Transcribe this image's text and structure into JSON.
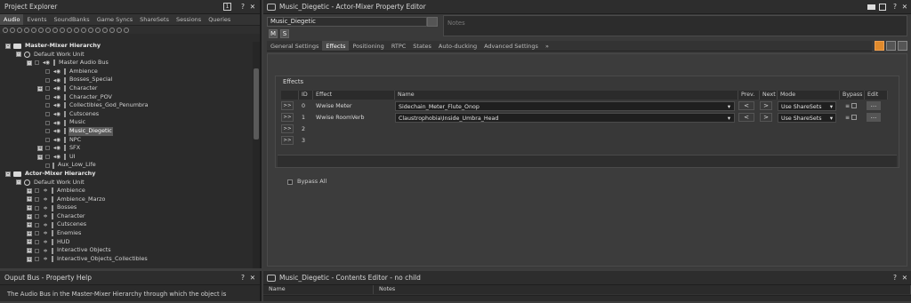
{
  "colors": {
    "accent": "#e08a2c",
    "panel": "#2b2b2b",
    "header": "#2d2d2d"
  },
  "project_explorer": {
    "title": "Project Explorer",
    "tabs": [
      "Audio",
      "Events",
      "SoundBanks",
      "Game Syncs",
      "ShareSets",
      "Sessions",
      "Queries"
    ],
    "tree": [
      {
        "label": "Master-Mixer Hierarchy",
        "indent": 0,
        "kind": "folder",
        "expander": "-",
        "header": true
      },
      {
        "label": "Default Work Unit",
        "indent": 1,
        "kind": "workunit",
        "expander": "-"
      },
      {
        "label": "Master Audio Bus",
        "indent": 2,
        "kind": "bus",
        "expander": "-"
      },
      {
        "label": "Ambience",
        "indent": 3,
        "kind": "bus",
        "expander": ""
      },
      {
        "label": "Bosses_Special",
        "indent": 3,
        "kind": "bus",
        "expander": ""
      },
      {
        "label": "Character",
        "indent": 3,
        "kind": "bus",
        "expander": "+"
      },
      {
        "label": "Character_POV",
        "indent": 3,
        "kind": "bus",
        "expander": ""
      },
      {
        "label": "Collectibles_God_Penumbra",
        "indent": 3,
        "kind": "bus",
        "expander": ""
      },
      {
        "label": "Cutscenes",
        "indent": 3,
        "kind": "bus",
        "expander": ""
      },
      {
        "label": "Music",
        "indent": 3,
        "kind": "bus",
        "expander": ""
      },
      {
        "label": "Music_Diegetic",
        "indent": 3,
        "kind": "bus",
        "expander": "",
        "selected": true
      },
      {
        "label": "NPC",
        "indent": 3,
        "kind": "bus",
        "expander": ""
      },
      {
        "label": "SFX",
        "indent": 3,
        "kind": "bus",
        "expander": "+"
      },
      {
        "label": "UI",
        "indent": 3,
        "kind": "bus",
        "expander": "+"
      },
      {
        "label": "Aux_Low_Life",
        "indent": 3,
        "kind": "bar",
        "expander": ""
      },
      {
        "label": "Actor-Mixer Hierarchy",
        "indent": 0,
        "kind": "folder",
        "expander": "-",
        "header": true
      },
      {
        "label": "Default Work Unit",
        "indent": 1,
        "kind": "workunit",
        "expander": "-"
      },
      {
        "label": "Ambience",
        "indent": 2,
        "kind": "mixer",
        "expander": "+"
      },
      {
        "label": "Ambience_Marzo",
        "indent": 2,
        "kind": "mixer",
        "expander": "+"
      },
      {
        "label": "Bosses",
        "indent": 2,
        "kind": "mixer",
        "expander": "+"
      },
      {
        "label": "Character",
        "indent": 2,
        "kind": "mixer",
        "expander": "+"
      },
      {
        "label": "Cutscenes",
        "indent": 2,
        "kind": "mixer",
        "expander": "+"
      },
      {
        "label": "Enemies",
        "indent": 2,
        "kind": "mixer",
        "expander": "+"
      },
      {
        "label": "HUD",
        "indent": 2,
        "kind": "mixer",
        "expander": "+"
      },
      {
        "label": "Interactive Objects",
        "indent": 2,
        "kind": "mixer",
        "expander": "+"
      },
      {
        "label": "Interactive_Objects_Collectibles",
        "indent": 2,
        "kind": "mixer",
        "expander": "+"
      }
    ]
  },
  "help": {
    "title": "Ouput Bus - Property Help",
    "text": "The Audio Bus in the Master-Mixer Hierarchy through which the object is"
  },
  "property_editor": {
    "title": "Music_Diegetic - Actor-Mixer Property Editor",
    "name_value": "Music_Diegetic",
    "notes_placeholder": "Notes",
    "m_label": "M",
    "s_label": "S",
    "tabs": [
      "General Settings",
      "Effects",
      "Positioning",
      "RTPC",
      "States",
      "Auto-ducking",
      "Advanced Settings",
      "»"
    ],
    "active_tab": 1,
    "effects_group": "Effects",
    "columns": [
      "ID",
      "Effect",
      "Name",
      "Prev.",
      "Next",
      "Mode",
      "Bypass",
      "Edit"
    ],
    "rows": [
      {
        "arrow": ">>",
        "id": "0",
        "effect": "Wwise Meter",
        "name": "Sidechain_Meter_Flute_Onop",
        "prev": "<",
        "next": ">",
        "mode": "Use ShareSets",
        "edit": "..."
      },
      {
        "arrow": ">>",
        "id": "1",
        "effect": "Wwise RoomVerb",
        "name": "Claustrophobia\\Inside_Umbra_Head",
        "prev": "<",
        "next": ">",
        "mode": "Use ShareSets",
        "edit": "..."
      },
      {
        "arrow": ">>",
        "id": "2",
        "effect": "",
        "name": "",
        "prev": "",
        "next": "",
        "mode": "",
        "edit": ""
      },
      {
        "arrow": ">>",
        "id": "3",
        "effect": "",
        "name": "",
        "prev": "",
        "next": "",
        "mode": "",
        "edit": ""
      }
    ],
    "bypass_all": "Bypass All"
  },
  "contents_editor": {
    "title": "Music_Diegetic - Contents Editor - no child",
    "columns": [
      "Name",
      "Notes"
    ]
  },
  "icons": {
    "help": "?",
    "close": "✕",
    "pin": "1"
  }
}
